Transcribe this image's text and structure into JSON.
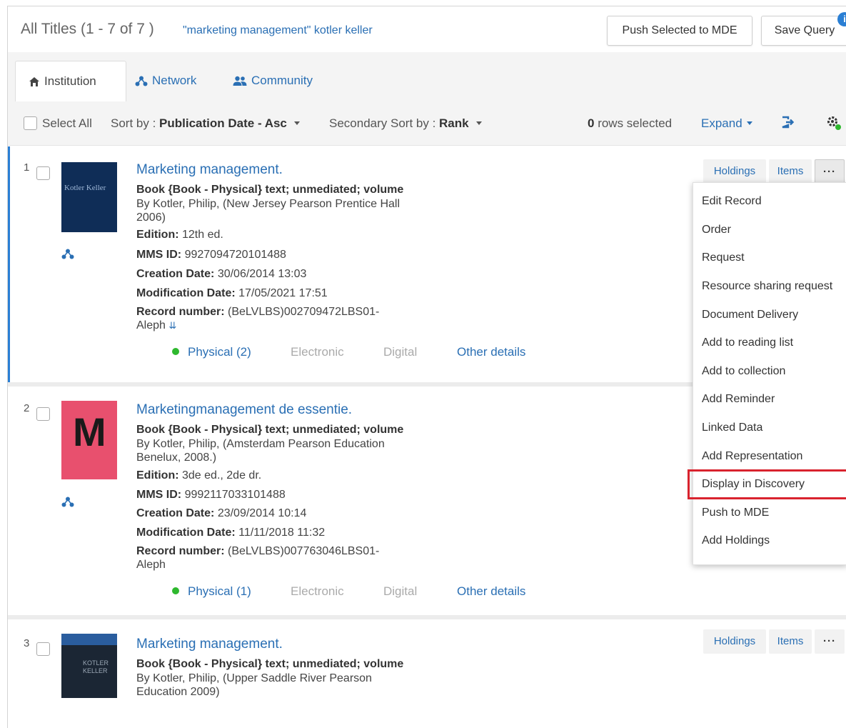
{
  "header": {
    "title": "All Titles (1 - 7 of 7 )",
    "query": "\"marketing management\" kotler keller",
    "push_label": "Push Selected to MDE",
    "save_label": "Save Query",
    "info_badge": "i"
  },
  "tabs": [
    {
      "label": "Institution",
      "icon": "home-icon"
    },
    {
      "label": "Network",
      "icon": "network-icon"
    },
    {
      "label": "Community",
      "icon": "users-icon"
    }
  ],
  "toolbar": {
    "select_all": "Select All",
    "sort_prefix": "Sort by : ",
    "sort_value": "Publication Date - Asc",
    "secondary_prefix": "Secondary Sort by : ",
    "secondary_value": "Rank",
    "rows_count": "0",
    "rows_label": " rows selected",
    "expand_label": "Expand"
  },
  "records": [
    {
      "num": "1",
      "title": "Marketing management.",
      "type": "Book {Book - Physical} text; unmediated; volume",
      "by": "By Kotler, Philip, (New Jersey Pearson Prentice Hall 2006)",
      "edition_label": "Edition:",
      "edition": "12th ed.",
      "mms_label": "MMS ID:",
      "mms": "9927094720101488",
      "created_label": "Creation Date:",
      "created": "30/06/2014 13:03",
      "modified_label": "Modification Date:",
      "modified": "17/05/2021 17:51",
      "record_label": "Record number:",
      "record": "(BeLVLBS)002709472LBS01-Aleph",
      "physical": "Physical (2)",
      "electronic": "Electronic",
      "digital": "Digital",
      "other": "Other details",
      "cover_text": "Kotler Keller"
    },
    {
      "num": "2",
      "title": "Marketingmanagement de essentie.",
      "type": "Book {Book - Physical} text; unmediated; volume",
      "by": "By Kotler, Philip, (Amsterdam Pearson Education Benelux, 2008.)",
      "edition_label": "Edition:",
      "edition": "3de ed., 2de dr.",
      "mms_label": "MMS ID:",
      "mms": "9992117033101488",
      "created_label": "Creation Date:",
      "created": "23/09/2014 10:14",
      "modified_label": "Modification Date:",
      "modified": "11/11/2018 11:32",
      "record_label": "Record number:",
      "record": "(BeLVLBS)007763046LBS01-Aleph",
      "physical": "Physical (1)",
      "electronic": "Electronic",
      "digital": "Digital",
      "other": "Other details",
      "cover_text": "M"
    },
    {
      "num": "3",
      "title": "Marketing management.",
      "type": "Book {Book - Physical} text; unmediated; volume",
      "by": "By Kotler, Philip, (Upper Saddle River Pearson Education 2009)",
      "cover_text": "KOTLER KELLER"
    }
  ],
  "row_actions": {
    "holdings": "Holdings",
    "items": "Items",
    "more": "···"
  },
  "menu": [
    "Edit Record",
    "Order",
    "Request",
    "Resource sharing request",
    "Document Delivery",
    "Add to reading list",
    "Add to collection",
    "Add Reminder",
    "Linked Data",
    "Add Representation",
    "Display in Discovery",
    "Push to MDE",
    "Add Holdings"
  ],
  "highlighted_menu_item": "Display in Discovery",
  "colors": {
    "link": "#2a6fb4",
    "highlight": "#d9232e",
    "available": "#2eb82e"
  }
}
